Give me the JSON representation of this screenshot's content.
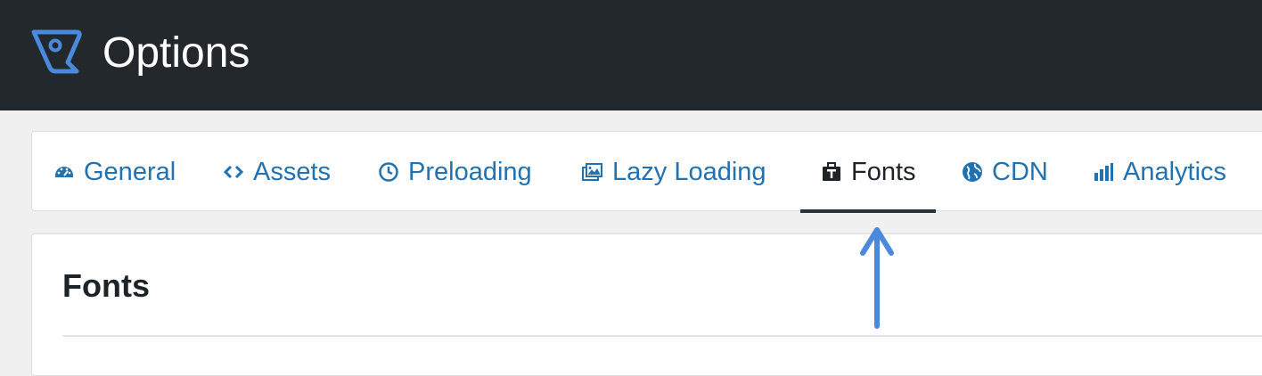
{
  "header": {
    "title": "Options",
    "logo_icon": "perfmatters-logo-icon",
    "background_color": "#23282d"
  },
  "tabs": [
    {
      "label": "General",
      "icon": "dashboard-gauge-icon",
      "active": false
    },
    {
      "label": "Assets",
      "icon": "code-brackets-icon",
      "active": false
    },
    {
      "label": "Preloading",
      "icon": "clock-icon",
      "active": false
    },
    {
      "label": "Lazy Loading",
      "icon": "images-icon",
      "active": false
    },
    {
      "label": "Fonts",
      "icon": "font-briefcase-icon",
      "active": true
    },
    {
      "label": "CDN",
      "icon": "globe-icon",
      "active": false
    },
    {
      "label": "Analytics",
      "icon": "bar-chart-icon",
      "active": false
    }
  ],
  "section": {
    "title": "Fonts"
  },
  "annotation": {
    "arrow_icon": "up-arrow-icon",
    "color": "#4a89dc"
  },
  "colors": {
    "link": "#2271b1",
    "active_text": "#1d2327",
    "active_underline": "#2c3338"
  }
}
